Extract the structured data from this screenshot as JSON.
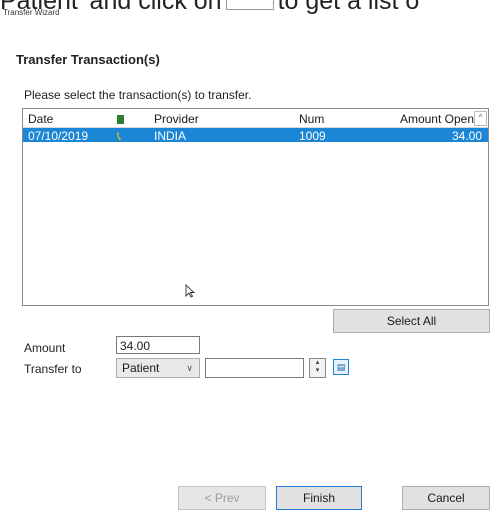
{
  "caption": {
    "before": "Patient' and click on",
    "after": "to get a list o"
  },
  "window": {
    "title": "Transfer Wizard"
  },
  "header": {
    "title": "Transfer Transaction(s)"
  },
  "instruction": "Please select the transaction(s) to transfer.",
  "table": {
    "columns": [
      "Date",
      "",
      "Provider",
      "Num",
      "Amount Open"
    ],
    "rows": [
      {
        "date": "07/10/2019",
        "icon": "phone-icon",
        "provider": "INDIA",
        "num": "1009",
        "amount_open": "34.00",
        "selected": true
      }
    ]
  },
  "select_all_label": "Select All",
  "amount": {
    "label": "Amount",
    "value": "34.00"
  },
  "transfer_to": {
    "label": "Transfer to",
    "selected": "Patient",
    "search_value": ""
  },
  "buttons": {
    "prev": "< Prev",
    "finish": "Finish",
    "cancel": "Cancel"
  },
  "colors": {
    "selection": "#1c86d6",
    "button_face": "#e1e1e1",
    "phone_icon": "#f5c400",
    "doc_icon": "#2f7d32"
  }
}
